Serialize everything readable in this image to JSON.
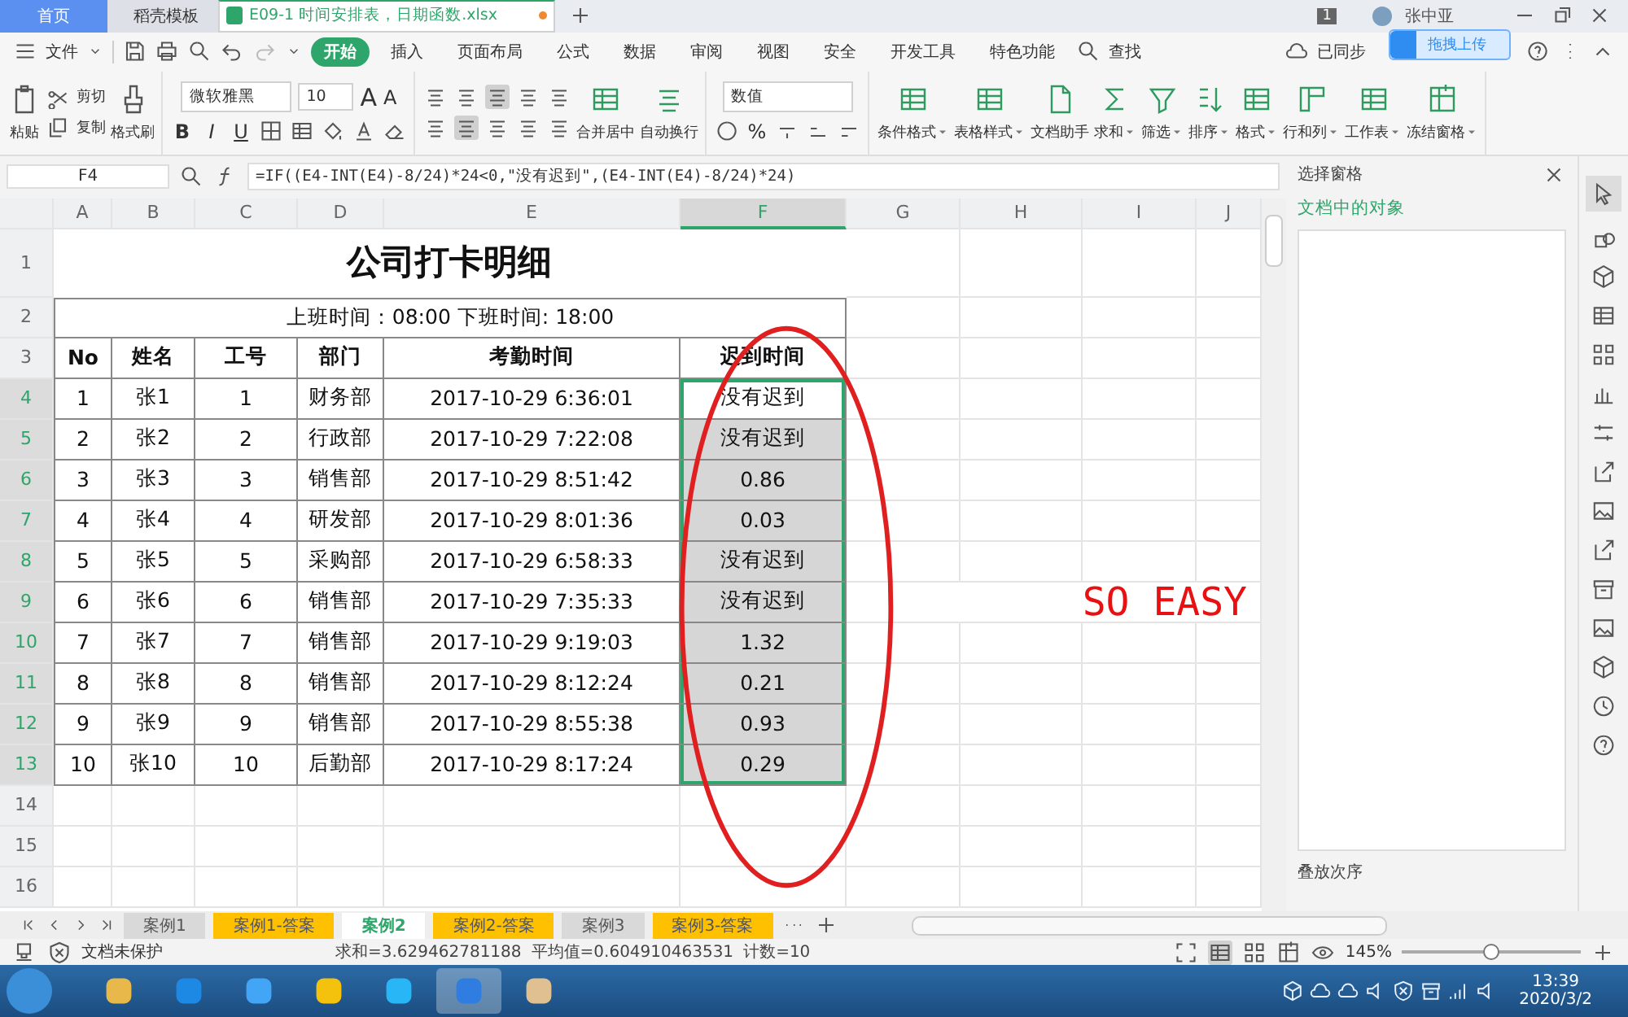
{
  "tabs": [
    {
      "label": "首页",
      "kind": "home",
      "selected": false
    },
    {
      "label": "稻壳模板",
      "kind": "template",
      "selected": false
    },
    {
      "label": "E09-1 时间安排表，日期函数.xlsx",
      "kind": "file",
      "selected": true,
      "modified": true
    }
  ],
  "title_bar": {
    "badge": "1",
    "user": "张中亚",
    "upload": "拖拽上传"
  },
  "menu": {
    "file": "文件",
    "items": [
      {
        "label": "开始",
        "selected": true
      },
      {
        "label": "插入",
        "selected": false
      },
      {
        "label": "页面布局",
        "selected": false
      },
      {
        "label": "公式",
        "selected": false
      },
      {
        "label": "数据",
        "selected": false
      },
      {
        "label": "审阅",
        "selected": false
      },
      {
        "label": "视图",
        "selected": false
      },
      {
        "label": "安全",
        "selected": false
      },
      {
        "label": "开发工具",
        "selected": false
      },
      {
        "label": "特色功能",
        "selected": false
      }
    ],
    "search": "查找",
    "sync": "已同步"
  },
  "ribbon": {
    "paste": "粘贴",
    "cut": "剪切",
    "copy": "复制",
    "format_painter": "格式刷",
    "font": "微软雅黑",
    "font_size": "10",
    "grow": "A",
    "shrink": "A",
    "bold": "B",
    "italic": "I",
    "underline": "U",
    "merge": "合并居中",
    "wrap": "自动换行",
    "number_format": "数值",
    "percent": "%",
    "tools": [
      {
        "label": "条件格式",
        "kind": "conditional",
        "dropdown": true
      },
      {
        "label": "表格样式",
        "kind": "style",
        "dropdown": true
      },
      {
        "label": "文档助手",
        "kind": "assistant",
        "dropdown": false
      },
      {
        "label": "求和",
        "kind": "sum",
        "dropdown": true
      },
      {
        "label": "筛选",
        "kind": "filter",
        "dropdown": true
      },
      {
        "label": "排序",
        "kind": "sort",
        "dropdown": true
      },
      {
        "label": "格式",
        "kind": "format",
        "dropdown": true
      },
      {
        "label": "行和列",
        "kind": "rowcol",
        "dropdown": true
      },
      {
        "label": "工作表",
        "kind": "sheet",
        "dropdown": true
      },
      {
        "label": "冻结窗格",
        "kind": "freeze",
        "dropdown": true
      }
    ]
  },
  "formula_bar": {
    "cell": "F4",
    "formula": "=IF((E4-INT(E4)-8/24)*24<0,\"没有迟到\",(E4-INT(E4)-8/24)*24)"
  },
  "columns": [
    {
      "label": "A",
      "selected": false
    },
    {
      "label": "B",
      "selected": false
    },
    {
      "label": "C",
      "selected": false
    },
    {
      "label": "D",
      "selected": false
    },
    {
      "label": "E",
      "selected": false
    },
    {
      "label": "F",
      "selected": true
    },
    {
      "label": "G",
      "selected": false
    },
    {
      "label": "H",
      "selected": false
    },
    {
      "label": "I",
      "selected": false
    },
    {
      "label": "J",
      "selected": false
    }
  ],
  "sheet": {
    "title": "公司打卡明细",
    "work_hours": "上班时间：08:00    下班时间: 18:00",
    "headers": [
      "No",
      "姓名",
      "工号",
      "部门",
      "考勤时间",
      "迟到时间"
    ],
    "records": [
      {
        "row": "4",
        "cells": [
          "1",
          "张1",
          "1",
          "财务部",
          "2017-10-29 6:36:01",
          "没有迟到"
        ],
        "selected": true,
        "active": true
      },
      {
        "row": "5",
        "cells": [
          "2",
          "张2",
          "2",
          "行政部",
          "2017-10-29 7:22:08",
          "没有迟到"
        ],
        "selected": true,
        "active": false
      },
      {
        "row": "6",
        "cells": [
          "3",
          "张3",
          "3",
          "销售部",
          "2017-10-29 8:51:42",
          "0.86"
        ],
        "selected": true,
        "active": false
      },
      {
        "row": "7",
        "cells": [
          "4",
          "张4",
          "4",
          "研发部",
          "2017-10-29 8:01:36",
          "0.03"
        ],
        "selected": true,
        "active": false
      },
      {
        "row": "8",
        "cells": [
          "5",
          "张5",
          "5",
          "采购部",
          "2017-10-29 6:58:33",
          "没有迟到"
        ],
        "selected": true,
        "active": false
      },
      {
        "row": "9",
        "cells": [
          "6",
          "张6",
          "6",
          "销售部",
          "2017-10-29 7:35:33",
          "没有迟到"
        ],
        "selected": true,
        "active": false
      },
      {
        "row": "10",
        "cells": [
          "7",
          "张7",
          "7",
          "销售部",
          "2017-10-29 9:19:03",
          "1.32"
        ],
        "selected": true,
        "active": false
      },
      {
        "row": "11",
        "cells": [
          "8",
          "张8",
          "8",
          "销售部",
          "2017-10-29 8:12:24",
          "0.21"
        ],
        "selected": true,
        "active": false
      },
      {
        "row": "12",
        "cells": [
          "9",
          "张9",
          "9",
          "销售部",
          "2017-10-29 8:55:38",
          "0.93"
        ],
        "selected": true,
        "active": false
      },
      {
        "row": "13",
        "cells": [
          "10",
          "张10",
          "10",
          "后勤部",
          "2017-10-29 8:17:24",
          "0.29"
        ],
        "selected": true,
        "active": false
      }
    ],
    "head_rows": [
      "1",
      "2",
      "3"
    ],
    "empty_rows": [
      "14",
      "15",
      "16"
    ],
    "annotation": "SO EASY"
  },
  "side_panel": {
    "title": "选择窗格",
    "section": "文档中的对象",
    "footer": "叠放次序"
  },
  "sheet_tabs": [
    {
      "label": "案例1",
      "selected": false,
      "color": "#d9d9d9"
    },
    {
      "label": "案例1-答案",
      "selected": false,
      "color": "#ffc000"
    },
    {
      "label": "案例2",
      "selected": true,
      "color": "#ffffff"
    },
    {
      "label": "案例2-答案",
      "selected": false,
      "color": "#ffc000"
    },
    {
      "label": "案例3",
      "selected": false,
      "color": "#d9d9d9"
    },
    {
      "label": "案例3-答案",
      "selected": false,
      "color": "#ffc000"
    }
  ],
  "status_bar": {
    "protection": "文档未保护",
    "sum": "求和=3.629462781188",
    "average": "平均值=0.604910463531",
    "count": "计数=10",
    "zoom": "145%",
    "zoom_slider": {
      "level": 0.45
    }
  },
  "taskbar": {
    "time": "13:39",
    "date": "2020/3/2"
  }
}
